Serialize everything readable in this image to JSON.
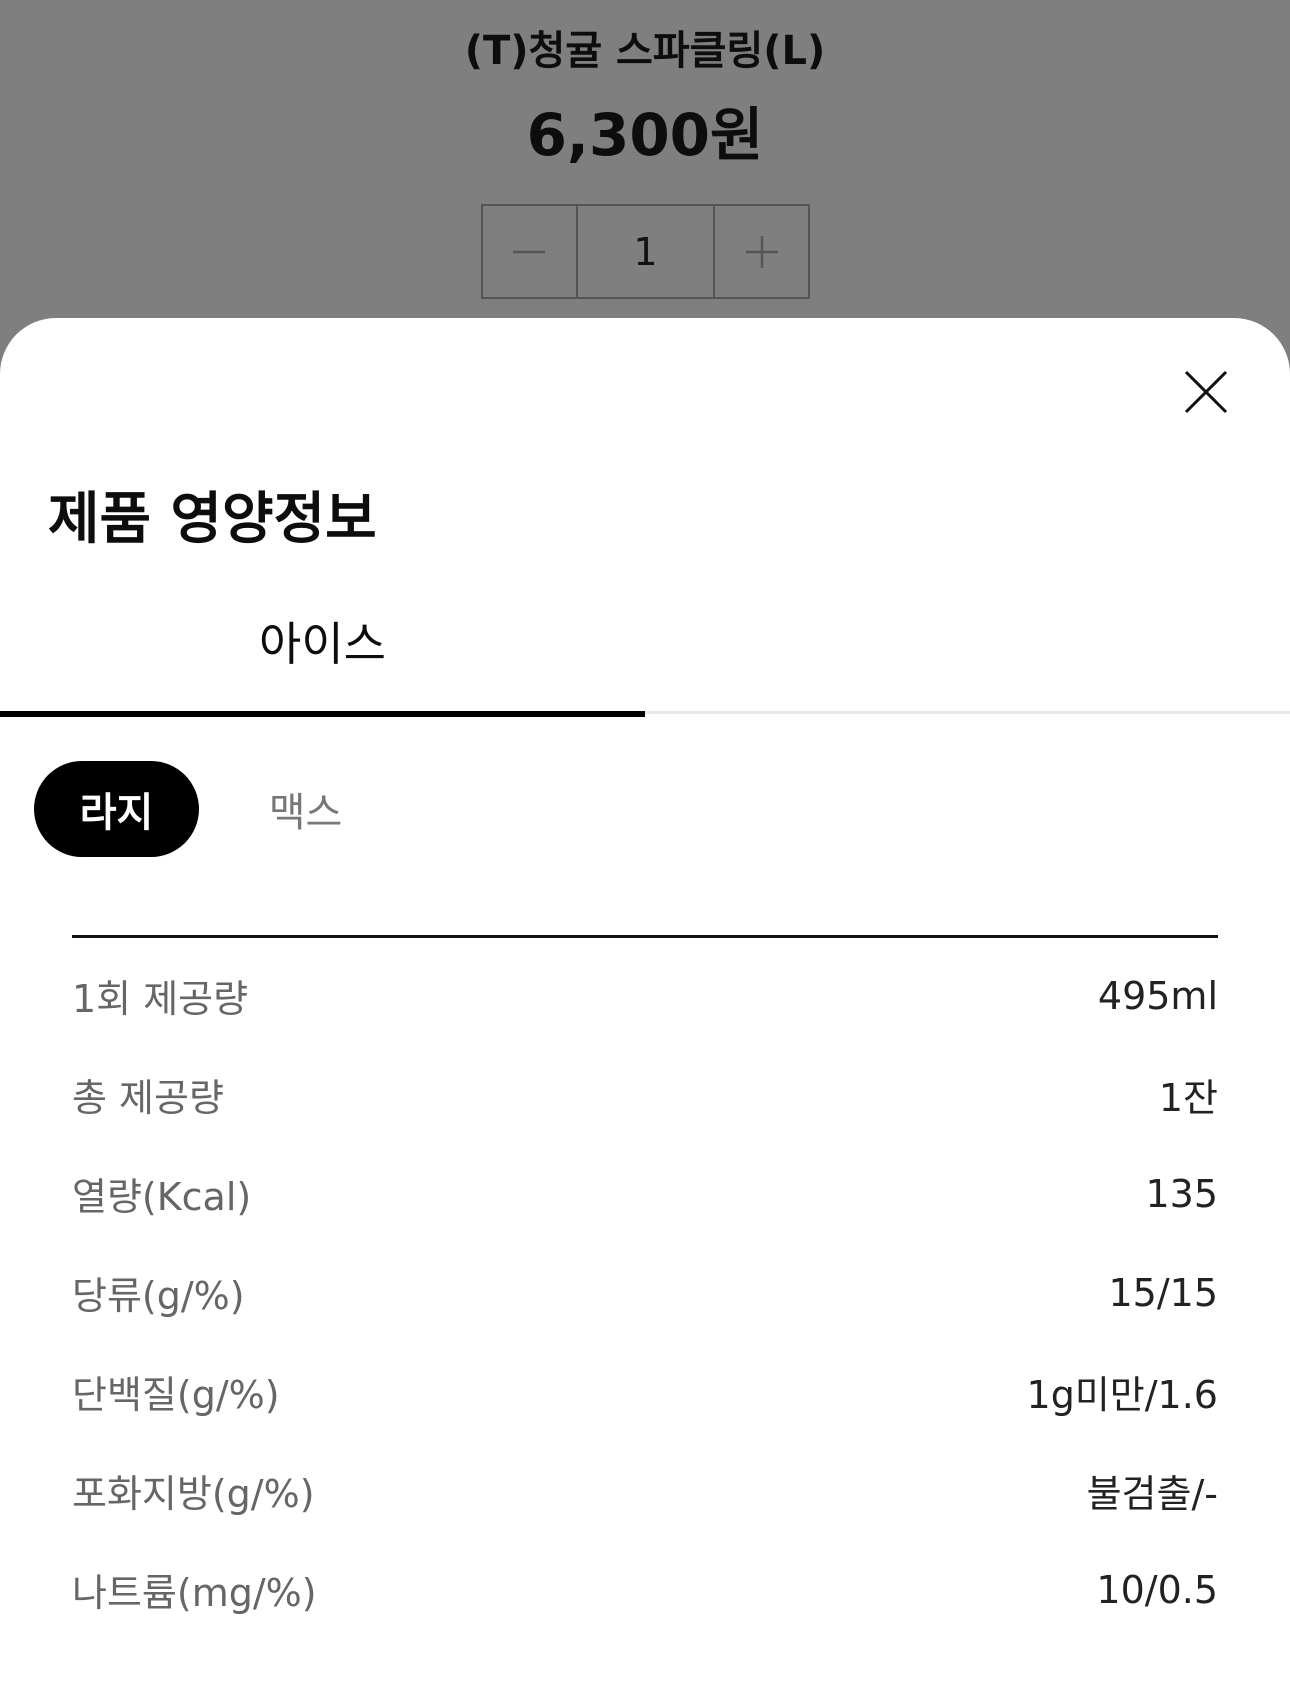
{
  "product": {
    "name": "(T)청귤 스파클링(L)",
    "price": "6,300원"
  },
  "stepper": {
    "minus": "−",
    "quantity": "1",
    "plus": "+"
  },
  "sheet": {
    "title": "제품 영양정보",
    "tabs": [
      {
        "label": "아이스",
        "active": true
      },
      {
        "label": "",
        "active": false
      }
    ],
    "sizes": [
      {
        "label": "라지",
        "selected": true
      },
      {
        "label": "맥스",
        "selected": false
      }
    ],
    "nutrition": [
      {
        "label": "1회 제공량",
        "value": "495ml"
      },
      {
        "label": "총 제공량",
        "value": "1잔"
      },
      {
        "label": "열량(Kcal)",
        "value": "135"
      },
      {
        "label": "당류(g/%)",
        "value": "15/15"
      },
      {
        "label": "단백질(g/%)",
        "value": "1g미만/1.6"
      },
      {
        "label": "포화지방(g/%)",
        "value": "불검출/-"
      },
      {
        "label": "나트륨(mg/%)",
        "value": "10/0.5"
      }
    ]
  },
  "icons": {
    "close": "close-icon"
  }
}
